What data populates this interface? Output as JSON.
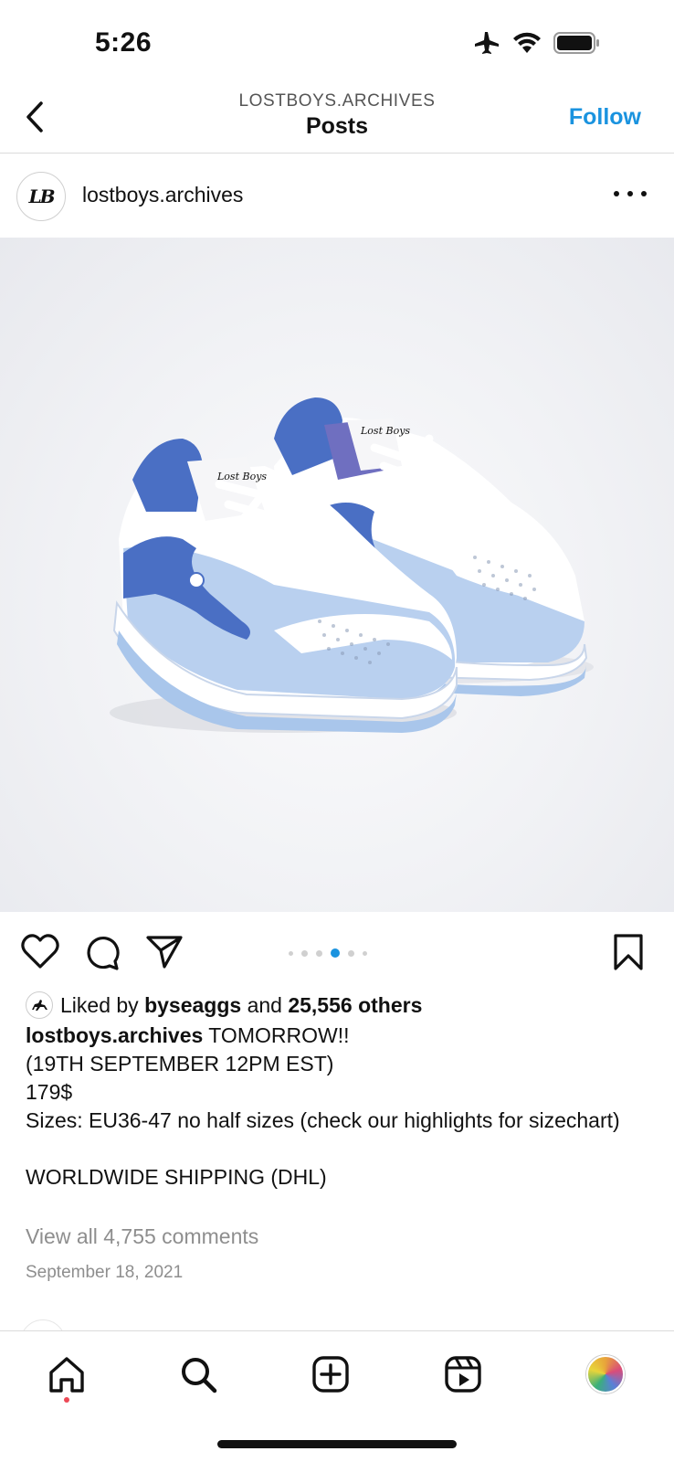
{
  "status_bar": {
    "time": "5:26",
    "icons": [
      "airplane-icon",
      "wifi-icon",
      "battery-icon"
    ]
  },
  "header": {
    "subtitle": "LOSTBOYS.ARCHIVES",
    "title": "Posts",
    "follow_label": "Follow",
    "back_icon": "chevron-left-icon"
  },
  "post": {
    "avatar_text": "LB",
    "username": "lostboys.archives",
    "more_icon": "more-horizontal-icon",
    "image_text": {
      "tongue_left": "Lost Boys",
      "tongue_right": "Lost Boys"
    },
    "actions": [
      "heart-icon",
      "comment-icon",
      "share-icon",
      "bookmark-icon"
    ],
    "carousel": {
      "count": 6,
      "active_index": 3
    },
    "likes": {
      "prefix": "Liked by",
      "user": "byseaggs",
      "middle": "and",
      "others": "25,556 others"
    },
    "caption": {
      "username": "lostboys.archives",
      "first_line": "TOMORROW!!",
      "lines": [
        "(19TH SEPTEMBER 12PM EST)",
        "179$",
        "Sizes: EU36-47 no half sizes (check our highlights for sizechart)",
        "",
        "WORLDWIDE SHIPPING (DHL)"
      ]
    },
    "comments_label": "View all 4,755 comments",
    "date": "September 18, 2021"
  },
  "tab_bar": {
    "tabs": [
      "home-icon",
      "search-icon",
      "create-icon",
      "reels-icon",
      "profile-icon"
    ],
    "active": "home-icon"
  },
  "colors": {
    "accent": "#1a93df",
    "text": "#111111",
    "muted": "#8e8e8e",
    "notification": "#ed4956",
    "shoe_light_blue": "#a9c6eb",
    "shoe_dark_blue": "#4a6fc4"
  }
}
